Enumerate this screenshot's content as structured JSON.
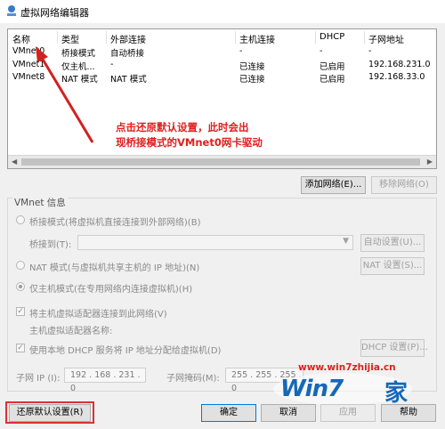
{
  "window": {
    "title": "虚拟网络编辑器"
  },
  "table": {
    "columns": [
      "名称",
      "类型",
      "外部连接",
      "主机连接",
      "DHCP",
      "子网地址"
    ],
    "rows": [
      [
        "VMnet0",
        "桥接模式",
        "自动桥接",
        "-",
        "-",
        "-"
      ],
      [
        "VMnet1",
        "仅主机...",
        "-",
        "已连接",
        "已启用",
        "192.168.231.0"
      ],
      [
        "VMnet8",
        "NAT 模式",
        "NAT 模式",
        "已连接",
        "已启用",
        "192.168.33.0"
      ]
    ]
  },
  "annotation": {
    "line1": "点击还原默认设置，此时会出",
    "line2": "现桥接模式的VMnet0网卡驱动",
    "color": "#e02020"
  },
  "buttons": {
    "add_network": "添加网络(E)...",
    "remove_network": "移除网络(O)",
    "auto_settings": "自动设置(U)...",
    "nat_settings": "NAT 设置(S)...",
    "dhcp_settings": "DHCP 设置(P)...",
    "restore_defaults": "还原默认设置(R)",
    "ok": "确定",
    "cancel": "取消",
    "apply": "应用",
    "help": "帮助"
  },
  "vmnet_info": {
    "title": "VMnet 信息",
    "bridged": "桥接模式(将虚拟机直接连接到外部网络)(B)",
    "bridged_to_label": "桥接到(T):",
    "nat": "NAT 模式(与虚拟机共享主机的 IP 地址)(N)",
    "host_only": "仅主机模式(在专用网络内连接虚拟机)(H)",
    "connect_adapter": "将主机虚拟适配器连接到此网络(V)",
    "adapter_name_label": "主机虚拟适配器名称:",
    "use_dhcp": "使用本地 DHCP 服务将 IP 地址分配给虚拟机(D)",
    "subnet_ip_label": "子网 IP (I):",
    "subnet_ip": "192 . 168 . 231 . 0",
    "subnet_mask_label": "子网掩码(M):",
    "subnet_mask": "255 . 255 . 255 . 0"
  },
  "watermark": {
    "url": "www.win7zhijia.cn",
    "logo": "Win7",
    "home": "家"
  }
}
